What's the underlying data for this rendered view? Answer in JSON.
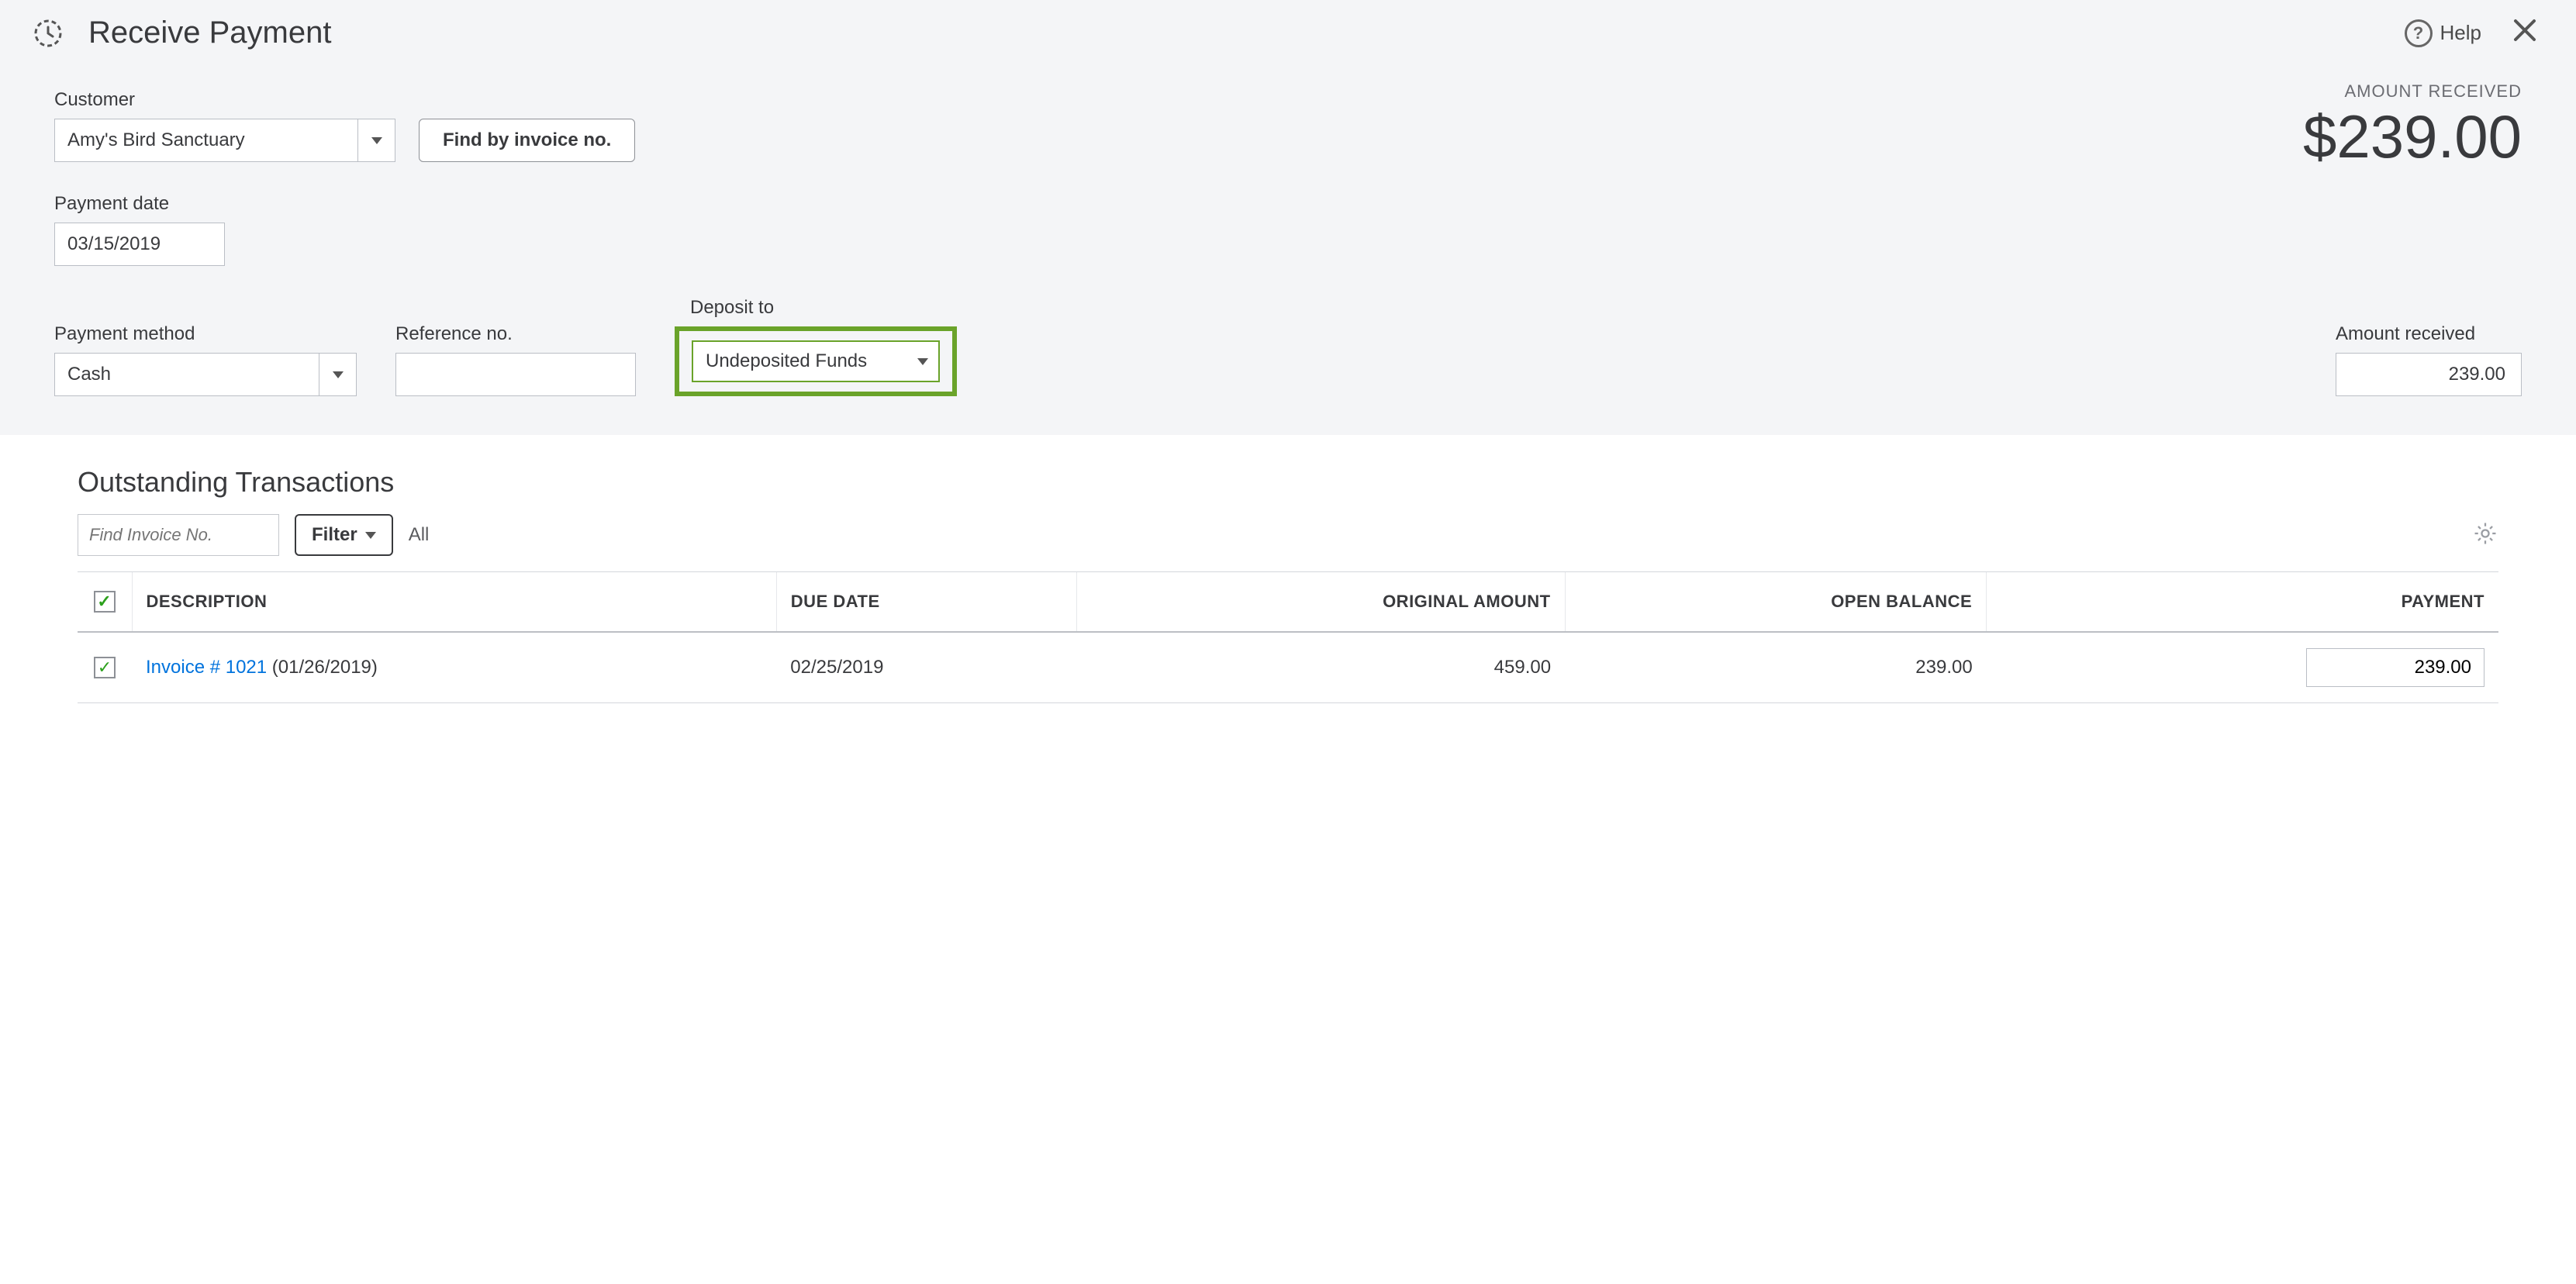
{
  "header": {
    "title": "Receive Payment",
    "help_label": "Help"
  },
  "customer_section": {
    "label": "Customer",
    "value": "Amy's Bird Sanctuary",
    "find_invoice_label": "Find by invoice no."
  },
  "amount_block": {
    "caption": "AMOUNT RECEIVED",
    "display": "$239.00"
  },
  "payment_date": {
    "label": "Payment date",
    "value": "03/15/2019"
  },
  "payment_method": {
    "label": "Payment method",
    "value": "Cash"
  },
  "reference_no": {
    "label": "Reference no.",
    "value": ""
  },
  "deposit_to": {
    "label": "Deposit to",
    "value": "Undeposited Funds"
  },
  "amount_received_field": {
    "label": "Amount received",
    "value": "239.00"
  },
  "transactions": {
    "title": "Outstanding Transactions",
    "find_placeholder": "Find Invoice No.",
    "filter_label": "Filter",
    "filter_scope": "All",
    "columns": {
      "description": "DESCRIPTION",
      "due_date": "DUE DATE",
      "original_amount": "ORIGINAL AMOUNT",
      "open_balance": "OPEN BALANCE",
      "payment": "PAYMENT"
    },
    "rows": [
      {
        "checked": true,
        "link_text": "Invoice # 1021",
        "desc_suffix": " (01/26/2019)",
        "due_date": "02/25/2019",
        "original_amount": "459.00",
        "open_balance": "239.00",
        "payment": "239.00"
      }
    ]
  }
}
